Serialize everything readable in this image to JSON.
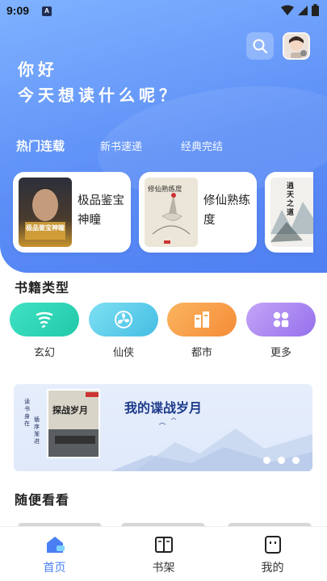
{
  "status": {
    "time": "9:09",
    "notif": "A"
  },
  "header": {
    "greeting_line1": "你好",
    "greeting_line2": "今天想读什么呢？"
  },
  "tabs": [
    {
      "label": "热门连载",
      "active": true
    },
    {
      "label": "新书速递",
      "active": false
    },
    {
      "label": "经典完结",
      "active": false
    }
  ],
  "books": [
    {
      "title": "极品鉴宝神瞳",
      "cover_text": "极品鉴宝神瞳"
    },
    {
      "title": "修仙熟练度",
      "cover_text": "修仙熟练度"
    },
    {
      "title": "",
      "cover_text": "逍天之道"
    }
  ],
  "categories": {
    "title": "书籍类型",
    "items": [
      {
        "label": "玄幻",
        "icon": "tornado-icon",
        "color": "#2fd6b8"
      },
      {
        "label": "仙侠",
        "icon": "fan-icon",
        "color": "#5dcce8"
      },
      {
        "label": "都市",
        "icon": "buildings-icon",
        "color": "#f7a04d"
      },
      {
        "label": "更多",
        "icon": "grid-icon",
        "color": "#a77ef0"
      }
    ]
  },
  "banner": {
    "title": "我的谍战岁月",
    "vertical_text_1": "读书身在",
    "vertical_text_2": "循序渐进",
    "cover_text": "探战岁月"
  },
  "random": {
    "title": "随便看看"
  },
  "nav": [
    {
      "label": "首页",
      "icon": "home-icon",
      "active": true
    },
    {
      "label": "书架",
      "icon": "book-icon",
      "active": false
    },
    {
      "label": "我的",
      "icon": "profile-icon",
      "active": false
    }
  ],
  "colors": {
    "accent": "#4a7ff3",
    "hero_top": "#7fb2ff",
    "hero_bottom": "#4f7ff2"
  }
}
